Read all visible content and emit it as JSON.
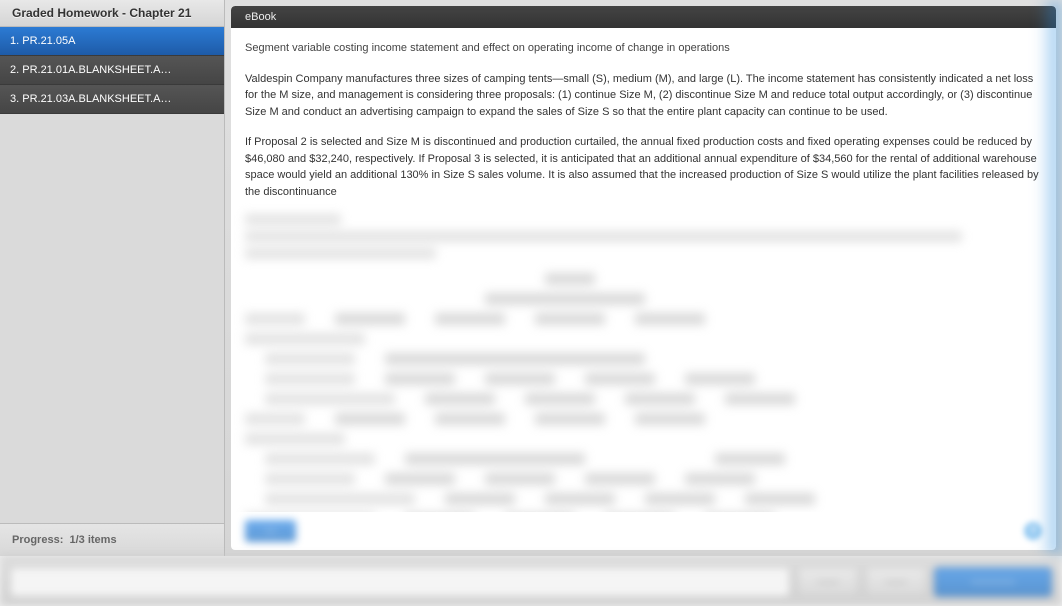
{
  "header": {
    "title": "Graded Homework - Chapter 21"
  },
  "sidebar": {
    "items": [
      {
        "label": "1. PR.21.05A",
        "active": true
      },
      {
        "label": "2. PR.21.01A.BLANKSHEET.A…",
        "active": false
      },
      {
        "label": "3. PR.21.03A.BLANKSHEET.A…",
        "active": false
      }
    ],
    "progress_label": "Progress:",
    "progress_value": "1/3 items"
  },
  "main": {
    "ebook_link": "eBook",
    "title": "Segment variable costing income statement and effect on operating income of change in operations",
    "para1": "Valdespin Company manufactures three sizes of camping tents—small (S), medium (M), and large (L). The income statement has consistently indicated a net loss for the M size, and management is considering three proposals: (1) continue Size M, (2) discontinue Size M and reduce total output accordingly, or (3) discontinue Size M and conduct an advertising campaign to expand the sales of Size S so that the entire plant capacity can continue to be used.",
    "para2": "If Proposal 2 is selected and Size M is discontinued and production curtailed, the annual fixed production costs and fixed operating expenses could be reduced by $46,080 and $32,240, respectively. If Proposal 3 is selected, it is anticipated that an additional annual expenditure of $34,560 for the rental of additional warehouse space would yield an additional 130% in Size S sales volume. It is also assumed that the increased production of Size S would utilize the plant facilities released by the discontinuance",
    "button_primary": "—",
    "help": "?"
  },
  "bottombar": {
    "btn1": "——",
    "btn2": "——",
    "btn3": "————"
  }
}
